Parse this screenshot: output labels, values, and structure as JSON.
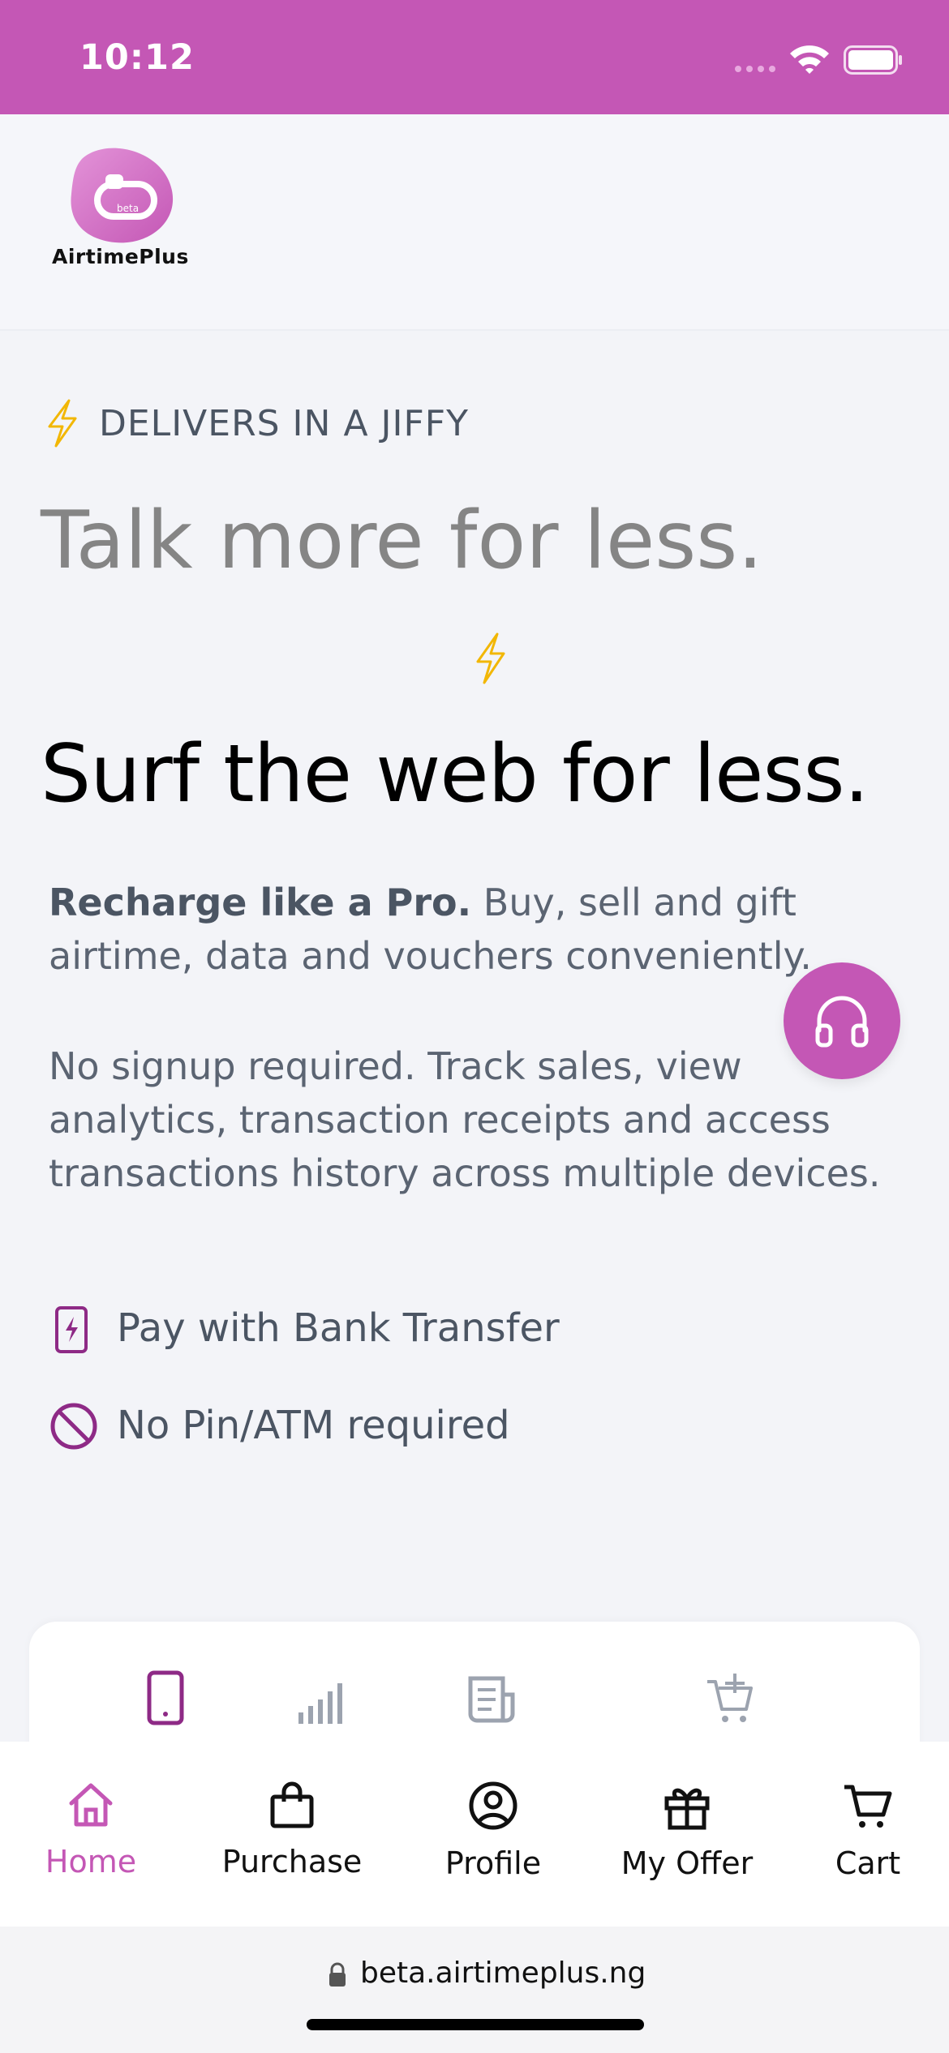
{
  "status_bar": {
    "time": "10:12"
  },
  "brand": {
    "logo_text": "AirtimePlus",
    "logo_badge": "beta"
  },
  "hero": {
    "kicker": "DELIVERS IN A JIFFY",
    "headline_1": "Talk more for less.",
    "headline_2": "Surf the web for less.",
    "intro_bold": "Recharge like a Pro.",
    "intro_rest": " Buy, sell and gift airtime, data and vouchers conveniently.",
    "paragraph_2": "No signup required. Track sales, view analytics, transaction receipts and access transactions history across multiple devices."
  },
  "features": [
    {
      "label": "Pay with Bank Transfer",
      "icon": "charging-phone-icon"
    },
    {
      "label": "No Pin/ATM required",
      "icon": "prohibited-icon"
    }
  ],
  "services": [
    {
      "icon": "phone-icon",
      "active": true
    },
    {
      "icon": "signal-bars-icon",
      "active": false
    },
    {
      "icon": "newspaper-icon",
      "active": false
    },
    {
      "icon": "cart-plus-icon",
      "active": false
    }
  ],
  "tabs": [
    {
      "label": "Home",
      "icon": "home-icon",
      "active": true
    },
    {
      "label": "Purchase",
      "icon": "shopping-bag-icon",
      "active": false
    },
    {
      "label": "Profile",
      "icon": "user-circle-icon",
      "active": false
    },
    {
      "label": "My Offer",
      "icon": "gift-icon",
      "active": false
    },
    {
      "label": "Cart",
      "icon": "cart-icon",
      "active": false
    }
  ],
  "browser": {
    "url": "beta.airtimeplus.ng"
  },
  "colors": {
    "accent": "#c457b5",
    "text_muted": "#5b6472",
    "bolt": "#f2b705"
  }
}
